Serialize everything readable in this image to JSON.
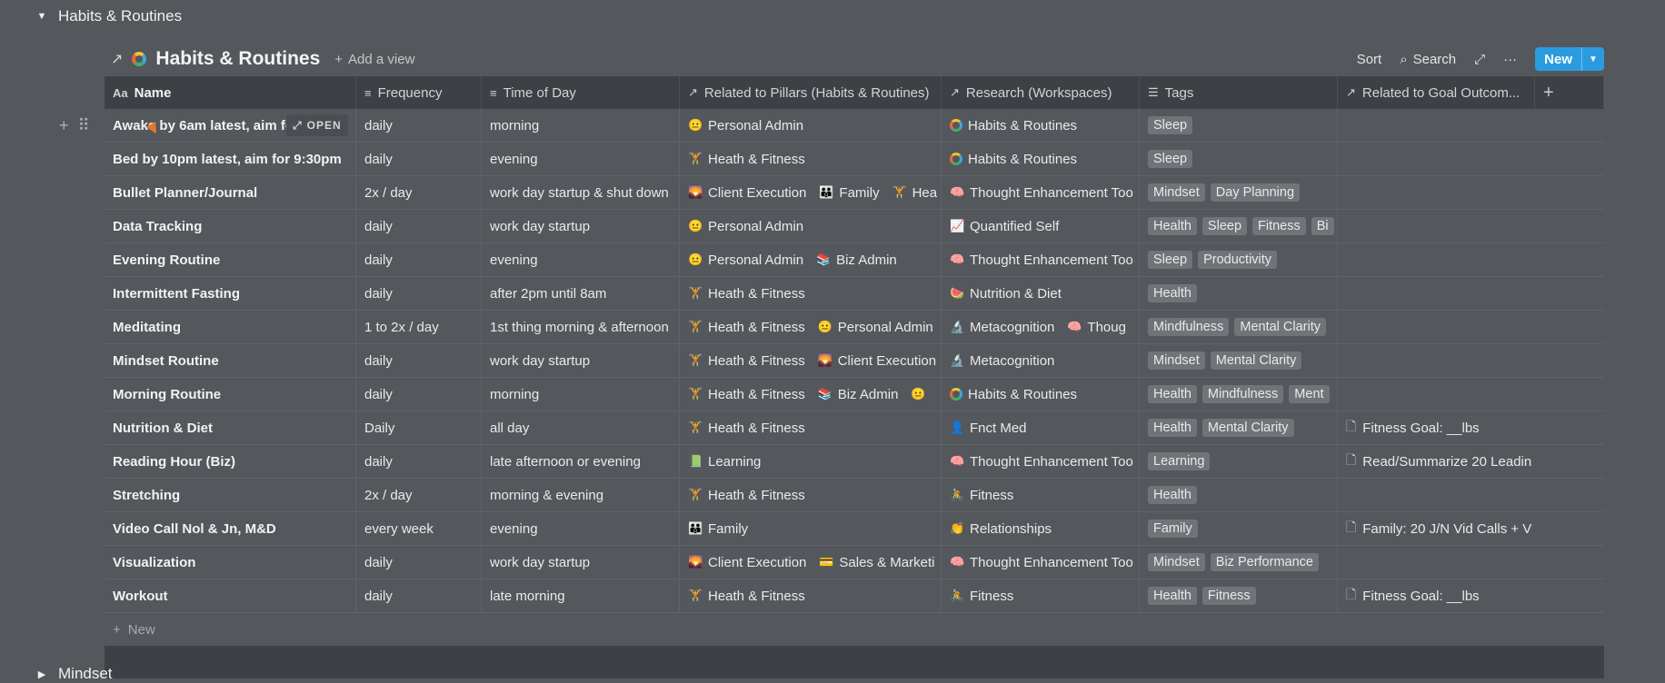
{
  "groups": {
    "top_label": "Habits & Routines",
    "bottom_label": "Mindset"
  },
  "db": {
    "title": "Habits & Routines",
    "add_view": "Add a view",
    "sort": "Sort",
    "search": "Search",
    "new": "New",
    "open": "OPEN",
    "new_row": "New"
  },
  "columns": [
    {
      "label": "Name",
      "icon": "text-icon"
    },
    {
      "label": "Frequency",
      "icon": "lines-icon"
    },
    {
      "label": "Time of Day",
      "icon": "lines-icon"
    },
    {
      "label": "Related to Pillars (Habits & Routines)",
      "icon": "relation-arrow-icon"
    },
    {
      "label": "Research (Workspaces)",
      "icon": "relation-arrow-icon"
    },
    {
      "label": "Tags",
      "icon": "list-icon"
    },
    {
      "label": "Related to Goal Outcom...",
      "icon": "relation-arrow-icon"
    }
  ],
  "rows": [
    {
      "name": "Awake by 6am latest, aim fo",
      "freq": "daily",
      "time": "morning",
      "pillars": [
        {
          "emo": "😐",
          "label": "Personal Admin"
        }
      ],
      "research": [
        {
          "emo": "ring",
          "label": "Habits & Routines"
        }
      ],
      "tags": [
        "Sleep"
      ],
      "goals": []
    },
    {
      "name": "Bed by 10pm latest, aim for 9:30pm",
      "freq": "daily",
      "time": "evening",
      "pillars": [
        {
          "emo": "🏋",
          "label": "Heath & Fitness"
        }
      ],
      "research": [
        {
          "emo": "ring",
          "label": "Habits & Routines"
        }
      ],
      "tags": [
        "Sleep"
      ],
      "goals": []
    },
    {
      "name": "Bullet Planner/Journal",
      "freq": "2x / day",
      "time": "work day startup & shut down",
      "pillars": [
        {
          "emo": "🌄",
          "label": "Client Execution"
        },
        {
          "emo": "👪",
          "label": "Family"
        },
        {
          "emo": "🏋",
          "label": "Hea"
        }
      ],
      "research": [
        {
          "emo": "🧠",
          "label": "Thought Enhancement Too"
        }
      ],
      "tags": [
        "Mindset",
        "Day Planning"
      ],
      "goals": []
    },
    {
      "name": "Data Tracking",
      "freq": "daily",
      "time": "work day startup",
      "pillars": [
        {
          "emo": "😐",
          "label": "Personal Admin"
        }
      ],
      "research": [
        {
          "emo": "📈",
          "label": "Quantified Self"
        }
      ],
      "tags": [
        "Health",
        "Sleep",
        "Fitness",
        "Bi"
      ],
      "goals": []
    },
    {
      "name": "Evening Routine",
      "freq": "daily",
      "time": "evening",
      "pillars": [
        {
          "emo": "😐",
          "label": "Personal Admin"
        },
        {
          "emo": "📚",
          "label": "Biz Admin"
        }
      ],
      "research": [
        {
          "emo": "🧠",
          "label": "Thought Enhancement Too"
        }
      ],
      "tags": [
        "Sleep",
        "Productivity"
      ],
      "goals": []
    },
    {
      "name": "Intermittent Fasting",
      "freq": "daily",
      "time": "after 2pm until 8am",
      "pillars": [
        {
          "emo": "🏋",
          "label": "Heath & Fitness"
        }
      ],
      "research": [
        {
          "emo": "🍉",
          "label": "Nutrition & Diet"
        }
      ],
      "tags": [
        "Health"
      ],
      "goals": []
    },
    {
      "name": "Meditating",
      "freq": "1 to 2x / day",
      "time": "1st thing morning & afternoon",
      "pillars": [
        {
          "emo": "🏋",
          "label": "Heath & Fitness"
        },
        {
          "emo": "😐",
          "label": "Personal Admin"
        }
      ],
      "research": [
        {
          "emo": "🔬",
          "label": "Metacognition"
        },
        {
          "emo": "🧠",
          "label": "Thoug"
        }
      ],
      "tags": [
        "Mindfulness",
        "Mental Clarity"
      ],
      "goals": []
    },
    {
      "name": "Mindset Routine",
      "freq": "daily",
      "time": "work day startup",
      "pillars": [
        {
          "emo": "🏋",
          "label": "Heath & Fitness"
        },
        {
          "emo": "🌄",
          "label": "Client Execution"
        }
      ],
      "research": [
        {
          "emo": "🔬",
          "label": "Metacognition"
        }
      ],
      "tags": [
        "Mindset",
        "Mental Clarity"
      ],
      "goals": []
    },
    {
      "name": "Morning Routine",
      "freq": "daily",
      "time": "morning",
      "pillars": [
        {
          "emo": "🏋",
          "label": "Heath & Fitness"
        },
        {
          "emo": "📚",
          "label": "Biz Admin"
        },
        {
          "emo": "😐",
          "label": ""
        }
      ],
      "research": [
        {
          "emo": "ring",
          "label": "Habits & Routines"
        }
      ],
      "tags": [
        "Health",
        "Mindfulness",
        "Ment"
      ],
      "goals": []
    },
    {
      "name": "Nutrition & Diet",
      "freq": "Daily",
      "time": "all day",
      "pillars": [
        {
          "emo": "🏋",
          "label": "Heath & Fitness"
        }
      ],
      "research": [
        {
          "emo": "👤",
          "label": "Fnct Med"
        }
      ],
      "tags": [
        "Health",
        "Mental Clarity"
      ],
      "goals": [
        "Fitness Goal: __lbs"
      ]
    },
    {
      "name": "Reading Hour (Biz)",
      "freq": "daily",
      "time": "late afternoon or evening",
      "pillars": [
        {
          "emo": "📗",
          "label": "Learning"
        }
      ],
      "research": [
        {
          "emo": "🧠",
          "label": "Thought Enhancement Too"
        }
      ],
      "tags": [
        "Learning"
      ],
      "goals": [
        "Read/Summarize 20 Leadin"
      ]
    },
    {
      "name": "Stretching",
      "freq": "2x / day",
      "time": "morning & evening",
      "pillars": [
        {
          "emo": "🏋",
          "label": "Heath & Fitness"
        }
      ],
      "research": [
        {
          "emo": "🚴",
          "label": "Fitness"
        }
      ],
      "tags": [
        "Health"
      ],
      "goals": []
    },
    {
      "name": "Video Call Nol & Jn, M&D",
      "freq": "every week",
      "time": "evening",
      "pillars": [
        {
          "emo": "👪",
          "label": "Family"
        }
      ],
      "research": [
        {
          "emo": "👏",
          "label": "Relationships"
        }
      ],
      "tags": [
        "Family"
      ],
      "goals": [
        "Family: 20 J/N Vid Calls + V"
      ]
    },
    {
      "name": "Visualization",
      "freq": "daily",
      "time": "work day startup",
      "pillars": [
        {
          "emo": "🌄",
          "label": "Client Execution"
        },
        {
          "emo": "💳",
          "label": "Sales & Marketi"
        }
      ],
      "research": [
        {
          "emo": "🧠",
          "label": "Thought Enhancement Too"
        }
      ],
      "tags": [
        "Mindset",
        "Biz Performance"
      ],
      "goals": []
    },
    {
      "name": "Workout",
      "freq": "daily",
      "time": "late morning",
      "pillars": [
        {
          "emo": "🏋",
          "label": "Heath & Fitness"
        }
      ],
      "research": [
        {
          "emo": "🚴",
          "label": "Fitness"
        }
      ],
      "tags": [
        "Health",
        "Fitness"
      ],
      "goals": [
        "Fitness Goal: __lbs"
      ]
    }
  ]
}
